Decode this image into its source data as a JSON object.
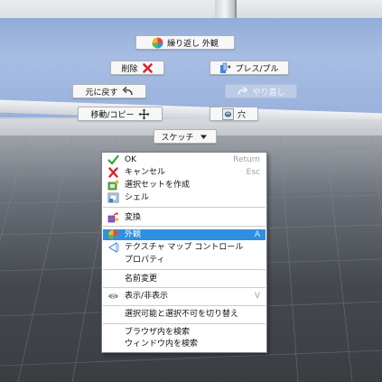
{
  "marking_menu": {
    "repeat_appearance": "繰り返し 外観",
    "delete": "削除",
    "press_pull": "プレス/プル",
    "undo": "元に戻す",
    "redo": "やり直し",
    "move_copy": "移動/コピー",
    "hole": "穴",
    "sketch": "スケッチ"
  },
  "context_menu": {
    "items": [
      {
        "label": "OK",
        "shortcut": "Return",
        "icon": "check-icon"
      },
      {
        "label": "キャンセル",
        "shortcut": "Esc",
        "icon": "cancel-icon"
      },
      {
        "label": "選択セットを作成",
        "shortcut": "",
        "icon": "selection-set-icon"
      },
      {
        "label": "シェル",
        "shortcut": "",
        "icon": "shell-icon"
      },
      {
        "label": "変換",
        "shortcut": "",
        "icon": "transform-icon"
      },
      {
        "label": "外観",
        "shortcut": "A",
        "icon": "appearance-icon",
        "highlighted": true
      },
      {
        "label": "テクスチャ マップ コントロール",
        "shortcut": "",
        "icon": "texture-map-icon"
      },
      {
        "label": "プロパティ",
        "shortcut": "",
        "icon": ""
      },
      {
        "label": "名前変更",
        "shortcut": "",
        "icon": ""
      },
      {
        "label": "表示/非表示",
        "shortcut": "V",
        "icon": "eye-icon"
      },
      {
        "label": "選択可能と選択不可を切り替え",
        "shortcut": "",
        "icon": ""
      },
      {
        "label": "ブラウザ内を検索",
        "shortcut": "",
        "icon": ""
      },
      {
        "label": "ウィンドウ内を検索",
        "shortcut": "",
        "icon": ""
      }
    ]
  },
  "colors": {
    "highlight": "#2f8fe0",
    "viewport_blue": "#a7bde4"
  }
}
